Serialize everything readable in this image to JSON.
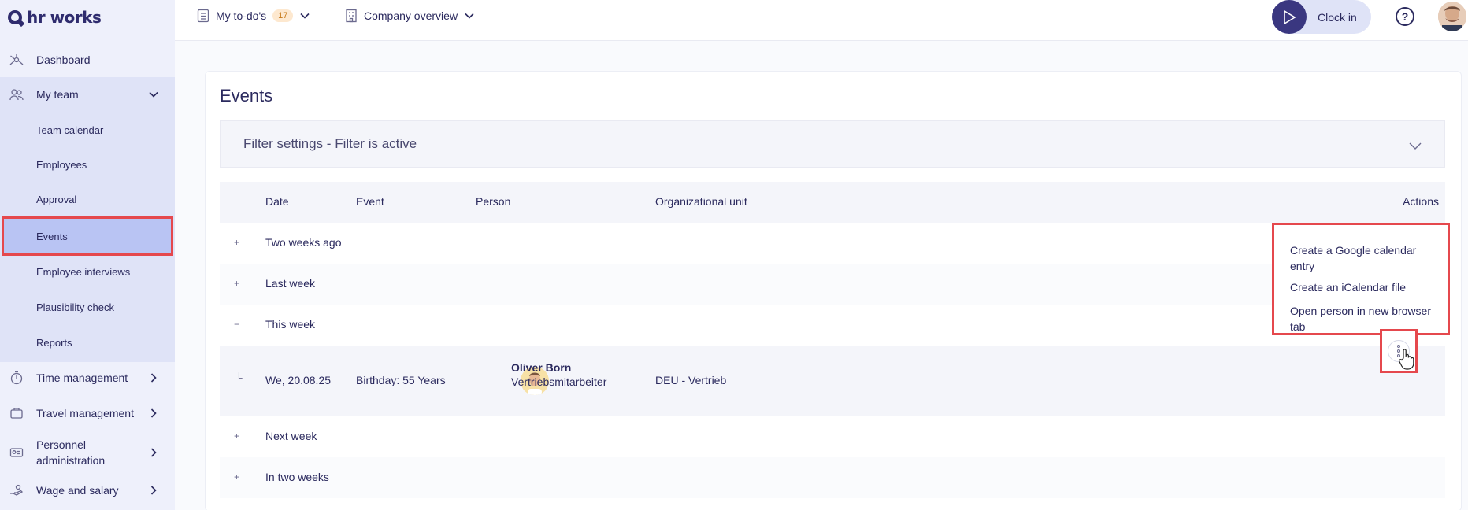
{
  "brand": {
    "name": "hr works"
  },
  "sidebar": {
    "items": [
      {
        "label": "Dashboard",
        "icon": "dashboard-icon"
      },
      {
        "label": "My team",
        "icon": "team-icon"
      },
      {
        "label": "Time management",
        "icon": "stopwatch-icon"
      },
      {
        "label": "Travel management",
        "icon": "suitcase-icon"
      },
      {
        "label": "Personnel administration",
        "icon": "id-card-icon"
      },
      {
        "label": "Wage and salary",
        "icon": "hand-money-icon"
      }
    ],
    "team_sub": [
      "Team calendar",
      "Employees",
      "Approval",
      "Events",
      "Employee interviews",
      "Plausibility check",
      "Reports"
    ],
    "active_item": "Events"
  },
  "topbar": {
    "todos_label": "My to-do's",
    "todos_count": "17",
    "company_label": "Company overview",
    "clockin_label": "Clock in",
    "help_glyph": "?"
  },
  "main": {
    "title": "Events",
    "filter_label": "Filter settings - Filter is active",
    "columns": [
      "Date",
      "Event",
      "Person",
      "Organizational unit",
      "Actions"
    ],
    "groups": [
      "Two weeks ago",
      "Last week",
      "This week",
      "Next week",
      "In two weeks"
    ],
    "group_markers": {
      "collapsed": "+",
      "expanded": "−",
      "child": "└"
    },
    "row": {
      "date": "We, 20.08.25",
      "event": "Birthday: 55 Years",
      "person_name": "Oliver Born",
      "person_role": "Vertriebsmitarbeiter",
      "org_unit": "DEU - Vertrieb"
    },
    "actions_menu": [
      "Create a Google calendar entry",
      "Create an iCalendar file",
      "Open person in new browser tab"
    ]
  },
  "colors": {
    "accent": "#3a3780",
    "highlight": "#e5484d",
    "sidebar_bg": "#eef0fb",
    "active_bg": "#b9c4f3"
  }
}
